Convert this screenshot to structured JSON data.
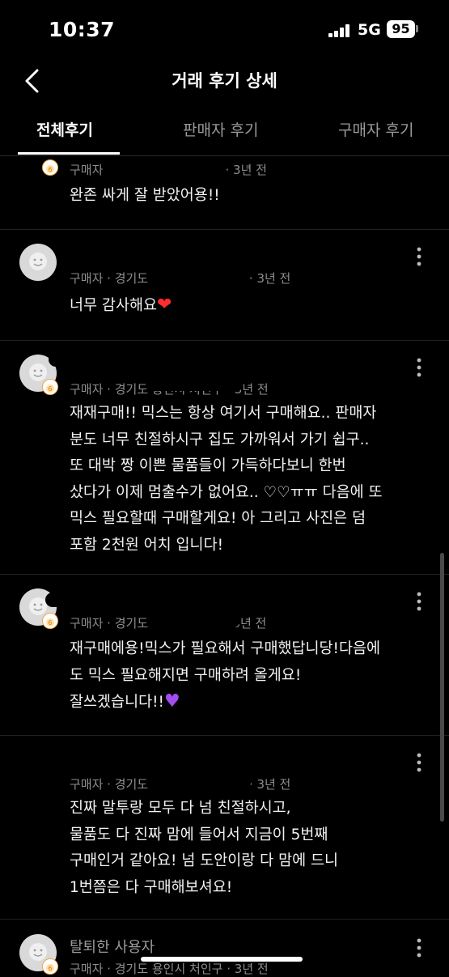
{
  "status": {
    "time": "10:37",
    "network": "5G",
    "battery": "95"
  },
  "header": {
    "title": "거래 후기 상세"
  },
  "tabs": [
    {
      "label": "전체후기",
      "active": true
    },
    {
      "label": "판매자 후기",
      "active": false
    },
    {
      "label": "구매자 후기",
      "active": false
    }
  ],
  "reviews": [
    {
      "role": "구매자",
      "time": "3년 전",
      "lines": [
        "완존 싸게 잘 받았어용!!"
      ]
    },
    {
      "role": "구매자",
      "location": "경기도",
      "time": "3년 전",
      "lines": [
        "너무 감사해요"
      ]
    },
    {
      "role": "구매자",
      "location": "경기도 용인시 처인구",
      "time": "3년 전",
      "lines": [
        "재재구매!! 믹스는 항상 여기서 구매해요.. 판매자",
        "분도 너무 친절하시구 집도 가까워서 가기 쉽구..",
        "또 대박 짱 이쁜 물품들이 가득하다보니 한번",
        "샀다가 이제 멈출수가 없어요.. ♡♡ㅠㅠ 다음에 또",
        "믹스 필요할때 구매할게요! 아 그리고 사진은 덤",
        "포함 2천원 어치 입니다!"
      ]
    },
    {
      "role": "구매자",
      "location": "경기도",
      "time": "3년 전",
      "lines": [
        "재구매에용!믹스가 필요해서 구매했답니당!다음에",
        "도 믹스 필요해지면 구매하려 올게요!",
        "잘쓰겠습니다!!"
      ]
    },
    {
      "role": "구매자",
      "location": "경기도",
      "time": "3년 전",
      "lines": [
        "진짜 말투랑 모두 다 넘 친절하시고,",
        "물품도 다 진짜 맘에 들어서 지금이 5번째",
        "구매인거 같아요! 넘 도안이랑 다 맘에 드니",
        "1번쯤은 다 구매해보셔요!"
      ]
    },
    {
      "name": "탈퇴한 사용자",
      "role": "구매자",
      "location": "경기도 용인시 처인구",
      "time": "3년 전",
      "lines": []
    }
  ]
}
